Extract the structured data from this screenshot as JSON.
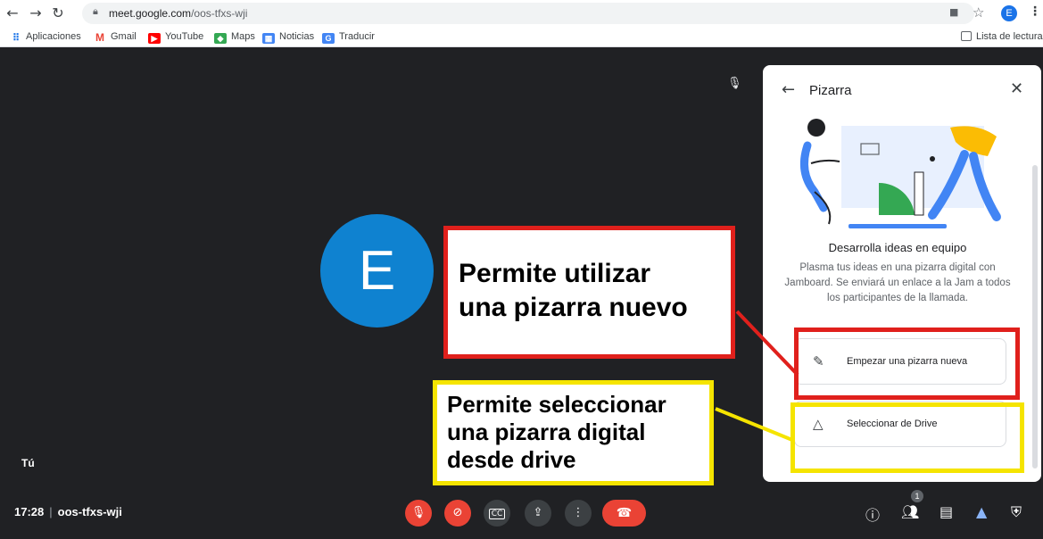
{
  "browser": {
    "url_host": "meet.google.com",
    "url_path": "/oos-tfxs-wji",
    "profile_initial": "E",
    "icons": {
      "back": "back-arrow-icon",
      "forward": "forward-arrow-icon",
      "reload": "reload-icon",
      "lock": "lock-icon",
      "camera": "camera-icon",
      "star": "bookmark-star-icon",
      "menu": "kebab-menu-icon"
    }
  },
  "bookmarks": {
    "items": [
      {
        "label": "Aplicaciones",
        "icon": "apps-grid-icon"
      },
      {
        "label": "Gmail",
        "icon": "gmail-icon"
      },
      {
        "label": "YouTube",
        "icon": "youtube-icon"
      },
      {
        "label": "Maps",
        "icon": "maps-icon"
      },
      {
        "label": "Noticias",
        "icon": "news-icon"
      },
      {
        "label": "Traducir",
        "icon": "translate-icon"
      }
    ],
    "reading_list": "Lista de lectura"
  },
  "stage": {
    "avatar_initial": "E",
    "self_label": "Tú"
  },
  "annotations": {
    "red_lines": [
      "Permite utilizar",
      "una pizarra nuevo"
    ],
    "yellow_lines": [
      "Permite seleccionar",
      "una pizarra digital",
      "desde drive"
    ]
  },
  "panel": {
    "title": "Pizarra",
    "heading": "Desarrolla ideas en equipo",
    "description": "Plasma tus ideas en una pizarra digital con Jamboard. Se enviará un enlace a la Jam a todos los participantes de la llamada.",
    "option_new": "Empezar una pizarra nueva",
    "option_drive": "Seleccionar de Drive"
  },
  "bottom": {
    "time": "17:28",
    "separator": "|",
    "meeting_code": "oos-tfxs-wji",
    "participants_count": "1"
  },
  "colors": {
    "background": "#202124",
    "annotation_red": "#e0201c",
    "annotation_yellow": "#f5e400",
    "avatar": "#0f82d0",
    "danger": "#ea4335"
  }
}
